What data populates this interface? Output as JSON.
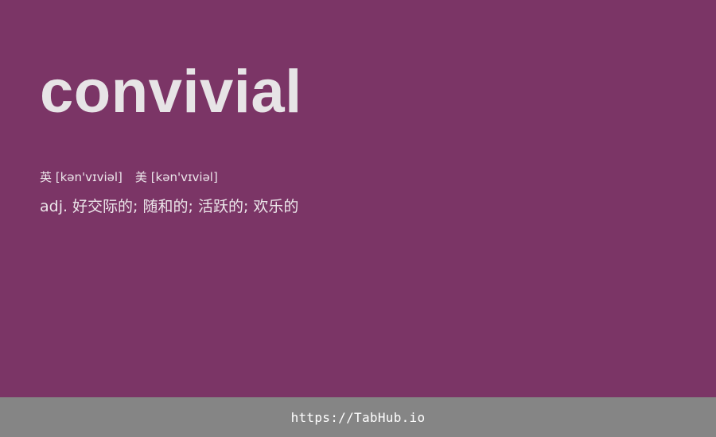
{
  "word": "convivial",
  "pronunciation": {
    "uk": "英 [kən'vɪviəl]",
    "us": "美 [kən'vɪviəl]"
  },
  "definition": "adj. 好交际的; 随和的; 活跃的;  欢乐的",
  "footer": {
    "link_text": "https://TabHub.io"
  },
  "colors": {
    "background": "#7b3566",
    "footer_background": "#858585",
    "text": "#e7e4e6"
  }
}
